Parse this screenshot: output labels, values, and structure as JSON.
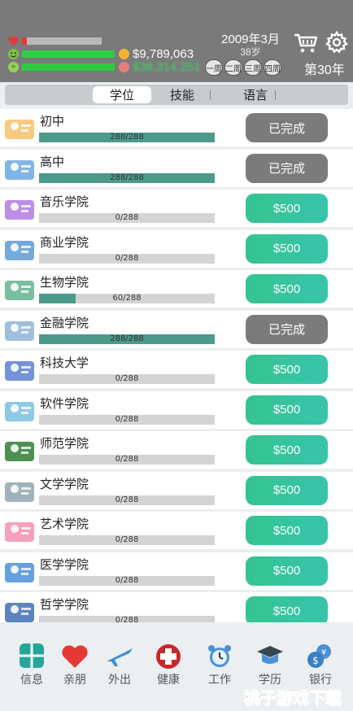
{
  "header": {
    "money": "$9,789,063",
    "money_blurred": "$38,314,251",
    "date": "2009年3月",
    "age": "38岁",
    "weeks": [
      "一周",
      "二周",
      "三周",
      "四周"
    ],
    "year": "第30年",
    "health_level": 0.06,
    "happiness_level": 1.0,
    "energy_level": 1.0
  },
  "tabs": [
    "学位",
    "技能",
    "语言"
  ],
  "courses": [
    {
      "name": "初中",
      "progress": "288/288",
      "pct": 1.0,
      "action": "已完成",
      "done": true,
      "icon": "students-icon"
    },
    {
      "name": "高中",
      "progress": "288/288",
      "pct": 1.0,
      "action": "已完成",
      "done": true,
      "icon": "highschool-students-icon"
    },
    {
      "name": "音乐学院",
      "progress": "0/288",
      "pct": 0,
      "action": "$500",
      "done": false,
      "icon": "music-icon"
    },
    {
      "name": "商业学院",
      "progress": "0/288",
      "pct": 0,
      "action": "$500",
      "done": false,
      "icon": "business-icon"
    },
    {
      "name": "生物学院",
      "progress": "60/288",
      "pct": 0.208,
      "action": "$500",
      "done": false,
      "icon": "biology-icon"
    },
    {
      "name": "金融学院",
      "progress": "288/288",
      "pct": 1.0,
      "action": "已完成",
      "done": true,
      "icon": "finance-icon"
    },
    {
      "name": "科技大学",
      "progress": "0/288",
      "pct": 0,
      "action": "$500",
      "done": false,
      "icon": "tech-icon"
    },
    {
      "name": "软件学院",
      "progress": "0/288",
      "pct": 0,
      "action": "$500",
      "done": false,
      "icon": "software-icon"
    },
    {
      "name": "师范学院",
      "progress": "0/288",
      "pct": 0,
      "action": "$500",
      "done": false,
      "icon": "teacher-icon"
    },
    {
      "name": "文学学院",
      "progress": "0/288",
      "pct": 0,
      "action": "$500",
      "done": false,
      "icon": "literature-icon"
    },
    {
      "name": "艺术学院",
      "progress": "0/288",
      "pct": 0,
      "action": "$500",
      "done": false,
      "icon": "art-icon"
    },
    {
      "name": "医学学院",
      "progress": "0/288",
      "pct": 0,
      "action": "$500",
      "done": false,
      "icon": "medicine-icon"
    },
    {
      "name": "哲学学院",
      "progress": "0/288",
      "pct": 0,
      "action": "$500",
      "done": false,
      "icon": "philosophy-icon"
    }
  ],
  "nav": [
    {
      "label": "信息",
      "icon": "info-icon"
    },
    {
      "label": "亲朋",
      "icon": "heart-icon"
    },
    {
      "label": "外出",
      "icon": "airplane-icon"
    },
    {
      "label": "健康",
      "icon": "medical-cross-icon"
    },
    {
      "label": "工作",
      "icon": "alarm-clock-icon"
    },
    {
      "label": "学历",
      "icon": "graduation-icon"
    },
    {
      "label": "银行",
      "icon": "bank-coins-icon"
    }
  ],
  "watermark": "桃子游戏下载",
  "colors": {
    "header": "#7a7a7a",
    "progress": "#4c9a8a",
    "buy_button": "#35c48f",
    "done_button": "#7b7b7b",
    "health_bar": "#e53935",
    "happy_bar": "#2ecc40"
  }
}
